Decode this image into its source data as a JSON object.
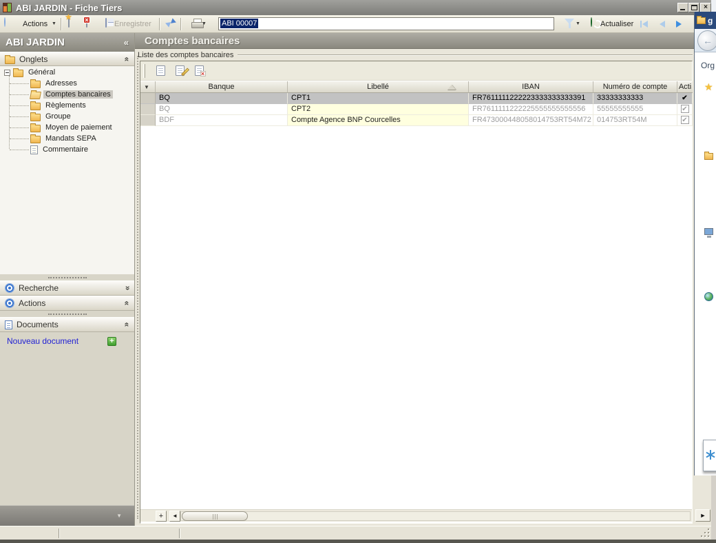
{
  "window": {
    "title": "ABI JARDIN -  Fiche Tiers"
  },
  "toolbar": {
    "actions_label": "Actions",
    "save_label": "Enregistrer",
    "record_input": "ABI 00007",
    "refresh_label": "Actualiser"
  },
  "sidebar": {
    "title": "ABI JARDIN",
    "onglets_label": "Onglets",
    "tree": {
      "root": "Général",
      "items": [
        {
          "label": "Adresses",
          "icon": "folder"
        },
        {
          "label": "Comptes bancaires",
          "icon": "folder-open",
          "selected": true
        },
        {
          "label": "Règlements",
          "icon": "folder"
        },
        {
          "label": "Groupe",
          "icon": "folder"
        },
        {
          "label": "Moyen de paiement",
          "icon": "folder"
        },
        {
          "label": "Mandats SEPA",
          "icon": "folder"
        },
        {
          "label": "Commentaire",
          "icon": "document"
        }
      ]
    },
    "sections": [
      {
        "label": "Recherche",
        "icon": "target",
        "chevron": "down"
      },
      {
        "label": "Actions",
        "icon": "target",
        "chevron": "up"
      },
      {
        "label": "Documents",
        "icon": "document",
        "chevron": "up"
      }
    ],
    "new_document_link": "Nouveau document"
  },
  "main": {
    "title": "Comptes bancaires",
    "group_label": "Liste des comptes bancaires",
    "table": {
      "columns": [
        "Banque",
        "Libellé",
        "IBAN",
        "Numéro de compte",
        "Acti"
      ],
      "rows": [
        {
          "banque": "BQ",
          "libelle": "CPT1",
          "iban": "FR7611111222223333333333391",
          "numero": "33333333333",
          "actif": true,
          "selected": true
        },
        {
          "banque": "BQ",
          "libelle": "CPT2",
          "iban": "FR7611111222225555555555556",
          "numero": "55555555555",
          "actif": true,
          "selected": false
        },
        {
          "banque": "BDF",
          "libelle": "Compte Agence BNP Courcelles",
          "iban": "FR473000448058014753RT54M72",
          "numero": "014753RT54M",
          "actif": true,
          "selected": false
        }
      ]
    }
  },
  "overlay_window": {
    "title_fragment": "g",
    "organize_label": "Org"
  },
  "icons": {
    "dropdown": "▼",
    "check": "✔",
    "collapse": "«",
    "plus": "+",
    "star": "★",
    "back": "←",
    "scroll_left": "◄",
    "scroll_right": "►",
    "close": "×"
  },
  "colors": {
    "titlebar_grey": "#8c8c88",
    "selection_navy": "#0a246a",
    "row_selected": "#c2c2c2",
    "editable_cell_yellow": "#ffffdf",
    "link_blue": "#1f1fd4",
    "accent_green": "#2f9e3f",
    "accent_blue": "#3a74cc",
    "panel_tan": "#d8d5c8"
  }
}
